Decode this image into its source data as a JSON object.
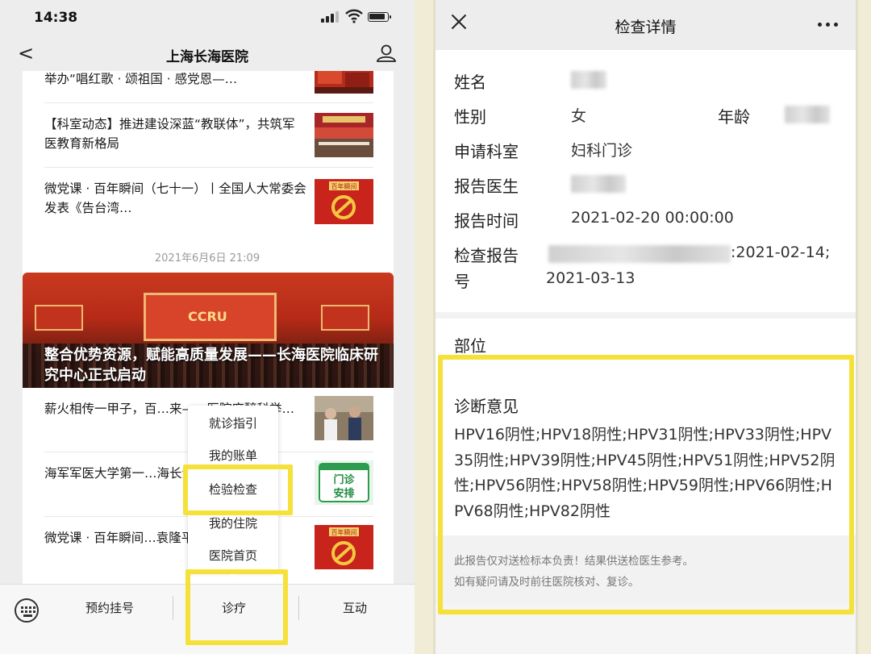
{
  "left": {
    "status_time": "14:38",
    "nav_title": "上海长海医院",
    "nav_back_glyph": "<",
    "news_top": [
      {
        "text": "举办“唱红歌 · 颂祖国 · 感党恩—…",
        "thumb": "red-banner"
      },
      {
        "text": "【科室动态】推进建设深蓝“教联体”，共筑军医教育新格局",
        "thumb": "conference-hall"
      },
      {
        "text": "微党课 · 百年瞬间（七十一）丨全国人大常委会发表《告台湾…",
        "thumb": "party-emblem"
      }
    ],
    "timestamp": "2021年6月6日 21:09",
    "banner_title": "整合优势资源，赋能高质量发展——长海医院临床研究中心正式启动",
    "banner_logo": "CCRU",
    "news_bottom": [
      {
        "text": "薪火相传一甲子，百…来——医院麻醉科举…",
        "thumb": "doctors-photo"
      },
      {
        "text": "海军军医大学第一…海长海医院）端午…",
        "thumb": "clinic-schedule"
      },
      {
        "text": "微党课 · 百年瞬间…袁隆平荣获新中国…",
        "thumb": "party-emblem"
      }
    ],
    "schedule_thumb_text": [
      "门诊",
      "安排"
    ],
    "emblem_thumb_text": "百年瞬间",
    "popup_items": [
      "就诊指引",
      "我的账单",
      "检验检查",
      "我的住院",
      "医院首页"
    ],
    "tabs": [
      "预约挂号",
      "诊疗",
      "互动"
    ]
  },
  "right": {
    "title": "检查详情",
    "fields": {
      "name_label": "姓名",
      "gender_label": "性别",
      "gender_value": "女",
      "age_label": "年龄",
      "dept_label": "申请科室",
      "dept_value": "妇科门诊",
      "doctor_label": "报告医生",
      "time_label": "报告时间",
      "time_value": "2021-02-20 00:00:00",
      "report_no_label_1": "检查报告",
      "report_no_label_2": "号",
      "report_no_value_1": ":2021-02-14;",
      "report_no_value_2": "2021-03-13"
    },
    "position_label": "部位",
    "diagnosis_title": "诊断意见",
    "diagnosis_text": "HPV16阴性;HPV18阴性;HPV31阴性;HPV33阴性;HPV35阴性;HPV39阴性;HPV45阴性;HPV51阴性;HPV52阴性;HPV56阴性;HPV58阴性;HPV59阴性;HPV66阴性;HPV68阴性;HPV82阴性",
    "disclaimer_1": "此报告仅对送检标本负责！结果供送检医生参考。",
    "disclaimer_2": "如有疑问请及时前往医院核对、复诊。"
  },
  "colors": {
    "highlight": "#f5e13a",
    "banner_red": "#c93a1f"
  }
}
